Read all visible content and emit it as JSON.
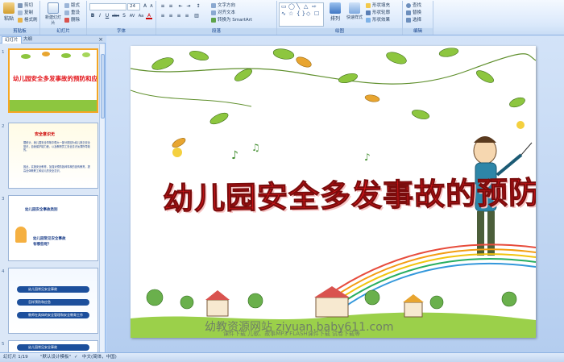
{
  "ribbon": {
    "clipboard": {
      "label": "剪贴板",
      "paste": "粘贴",
      "cut": "剪切",
      "copy": "复制",
      "format_painter": "格式刷"
    },
    "slides": {
      "label": "幻灯片",
      "new_slide": "新建幻灯片",
      "layout": "版式",
      "reset": "重设",
      "delete": "删除"
    },
    "font": {
      "label": "字体",
      "font_size": "24",
      "bold": "B",
      "italic": "I",
      "underline": "U",
      "strike": "abc",
      "shadow": "S",
      "spacing": "AV",
      "case": "Aa",
      "color": "A"
    },
    "paragraph": {
      "label": "段落",
      "text_direction": "文字方向",
      "align_text": "对齐文本",
      "smartart": "转换为 SmartArt"
    },
    "drawing": {
      "label": "绘图",
      "arrange": "排列",
      "quick_styles": "快速样式",
      "shape_fill": "形状填充",
      "shape_outline": "形状轮廓",
      "shape_effects": "形状效果"
    },
    "editing": {
      "label": "编辑",
      "find": "查找",
      "replace": "替换",
      "select": "选择"
    }
  },
  "panel": {
    "tab_slides": "幻灯片",
    "tab_outline": "大纲",
    "close": "×",
    "slides": [
      {
        "num": "1",
        "title": "幼儿园安全多发事故的预防和应急"
      },
      {
        "num": "2",
        "title": "安全意识无",
        "body1": "据统计，我儿园安全事故中很大一部分是因为幼儿缺乏安全常识，自我保护能力差，以及教职员工安全意识淡薄所导致的。",
        "body2": "因此，实施安全教育，加强对预防各种事故的宣传教育，提高全体教职工和幼儿的安全意识。"
      },
      {
        "num": "3",
        "title": "幼儿园安全事故类别",
        "sub": "幼儿园常见安全事故",
        "sub2": "有哪些呢？"
      },
      {
        "num": "4",
        "items": [
          "幼儿园常见安全事故",
          "怎样预防和应急",
          "教师在具体的安全管理和安全教育工作"
        ]
      },
      {
        "num": "5",
        "title": "幼儿园常见安全事故"
      }
    ]
  },
  "slide": {
    "title": "幼儿园安全多发事故的预防和应急",
    "watermark": "幼教资源网站 ziyuan.baby611.com",
    "watermark_sub": "课件下载  儿歌、故事MP3  FLASH课件下载  试卷下载等"
  },
  "status": {
    "slide_info": "幻灯片 1/19",
    "theme": "\"默认设计模板\"",
    "language": "中文(简体，中国)"
  },
  "colors": {
    "title_red": "#e3141a",
    "leaf_green": "#7cc242",
    "ribbon_blue": "#15428b"
  }
}
